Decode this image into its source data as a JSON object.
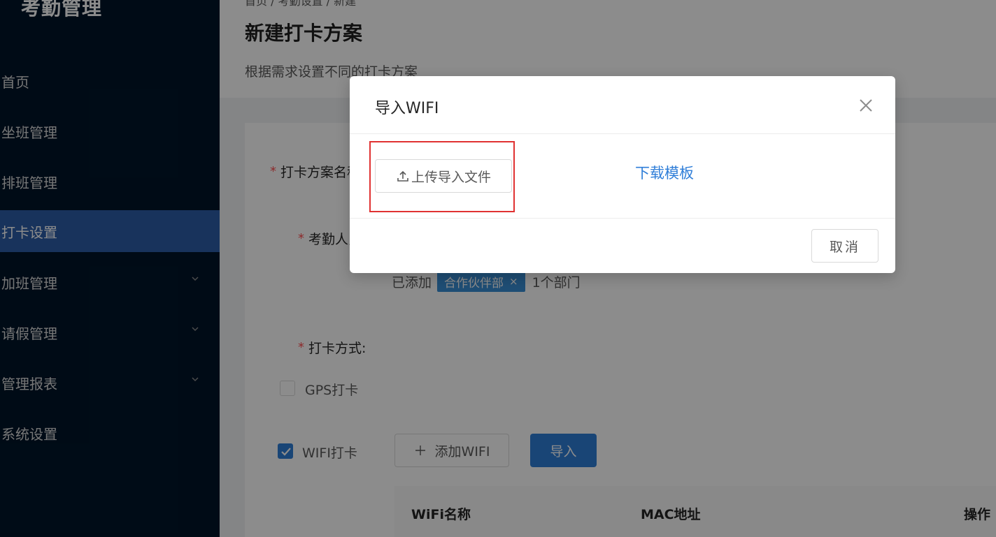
{
  "sidebar": {
    "logo": "考勤管理",
    "items": [
      {
        "label": "首页"
      },
      {
        "label": "坐班管理"
      },
      {
        "label": "排班管理"
      },
      {
        "label": "打卡设置"
      },
      {
        "label": "加班管理"
      },
      {
        "label": "请假管理"
      },
      {
        "label": "管理报表"
      },
      {
        "label": "系统设置"
      }
    ]
  },
  "header": {
    "breadcrumb": "首页 / 考勤设置 / 新建",
    "title": "新建打卡方案",
    "description": "根据需求设置不同的打卡方案"
  },
  "form": {
    "plan_name_label": "打卡方案名称",
    "attendees_label": "考勤人员",
    "added_prefix": "已添加",
    "department_tag": "合作伙伴部",
    "tag_close": "×",
    "department_count": "1个部门",
    "method_label": "打卡方式:",
    "gps_label": "GPS打卡",
    "wifi_label": "WIFI打卡",
    "add_wifi_button": "添加WIFI",
    "import_button": "导入",
    "required_mark": "*",
    "table_headers": [
      "WiFi名称",
      "MAC地址",
      "操作"
    ]
  },
  "modal": {
    "title": "导入WIFI",
    "upload_button": "上传导入文件",
    "download_link": "下载模板",
    "cancel_button": "取消"
  },
  "colors": {
    "sidebar_bg": "#001529",
    "active_item": "#2c5ea8",
    "primary": "#2f7ed8",
    "highlight_border": "#e03131"
  }
}
